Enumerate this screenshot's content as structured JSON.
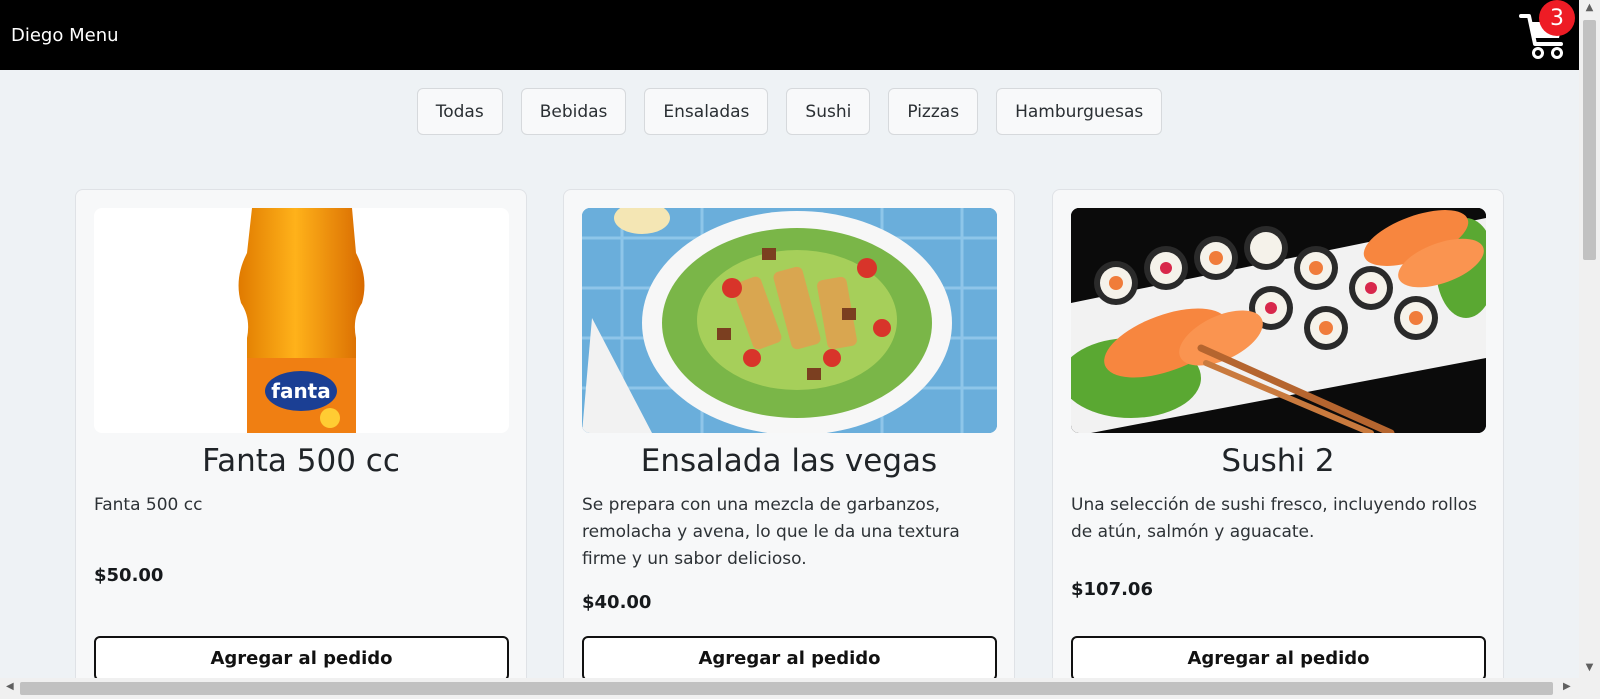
{
  "navbar": {
    "brand": "Diego Menu",
    "cart_count": "3"
  },
  "categories": [
    "Todas",
    "Bebidas",
    "Ensaladas",
    "Sushi",
    "Pizzas",
    "Hamburguesas"
  ],
  "products": [
    {
      "title": "Fanta 500 cc",
      "description": "Fanta 500 cc",
      "price": "$50.00",
      "button": "Agregar al pedido",
      "image": "fanta-bottle-photo"
    },
    {
      "title": "Ensalada las vegas",
      "description": "Se prepara con una mezcla de garbanzos, remolacha y avena, lo que le da una textura firme y un sabor delicioso.",
      "price": "$40.00",
      "button": "Agregar al pedido",
      "image": "salad-plate-photo"
    },
    {
      "title": "Sushi 2",
      "description": "Una selección de sushi fresco, incluyendo rollos de atún, salmón y aguacate.",
      "price": "$107.06",
      "button": "Agregar al pedido",
      "image": "sushi-platter-photo"
    }
  ],
  "colors": {
    "navbar": "#000000",
    "badge": "#ee1c25",
    "page_bg": "#eef2f5"
  }
}
